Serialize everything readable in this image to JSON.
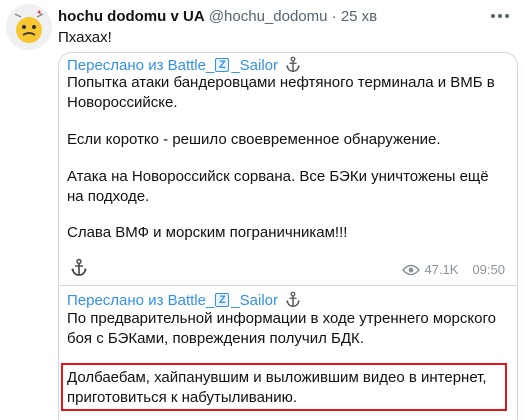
{
  "tweet": {
    "display_name": "hochu dodomu v UA",
    "handle": "@hochu_dodomu",
    "separator": "·",
    "time": "25 хв",
    "text": "Пхахах!"
  },
  "quoted": {
    "post1": {
      "forwarded_prefix": "Переслано из Battle_",
      "forwarded_badge": "Z",
      "forwarded_suffix": "_Sailor",
      "paragraphs": [
        "Попытка атаки бандеровцами нефтяного терминала и ВМБ в Новороссийске.",
        "Если коротко - решило своевременное обнаружение.",
        "Атака на Новороссийск сорвана. Все БЭКи уничтожены ещё на подходе.",
        "Слава ВМФ и морским пограничникам!!!"
      ],
      "views": "47.1K",
      "time": "09:50"
    },
    "post2": {
      "forwarded_prefix": "Переслано из Battle_",
      "forwarded_badge": "Z",
      "forwarded_suffix": "_Sailor",
      "paragraphs": [
        "По предварительной информации в ходе утреннего морского боя с БЭКами, повреждения получил БДК.",
        "Долбаебам, хайпанувшим и выложившим видео в интернет, приготовиться к набутыливанию."
      ]
    }
  },
  "colors": {
    "link": "#3390ec",
    "highlight": "#e5131b",
    "muted": "#536471"
  },
  "icons": [
    "avatar",
    "more-icon",
    "z-badge",
    "anchor-icon",
    "eye-icon"
  ]
}
